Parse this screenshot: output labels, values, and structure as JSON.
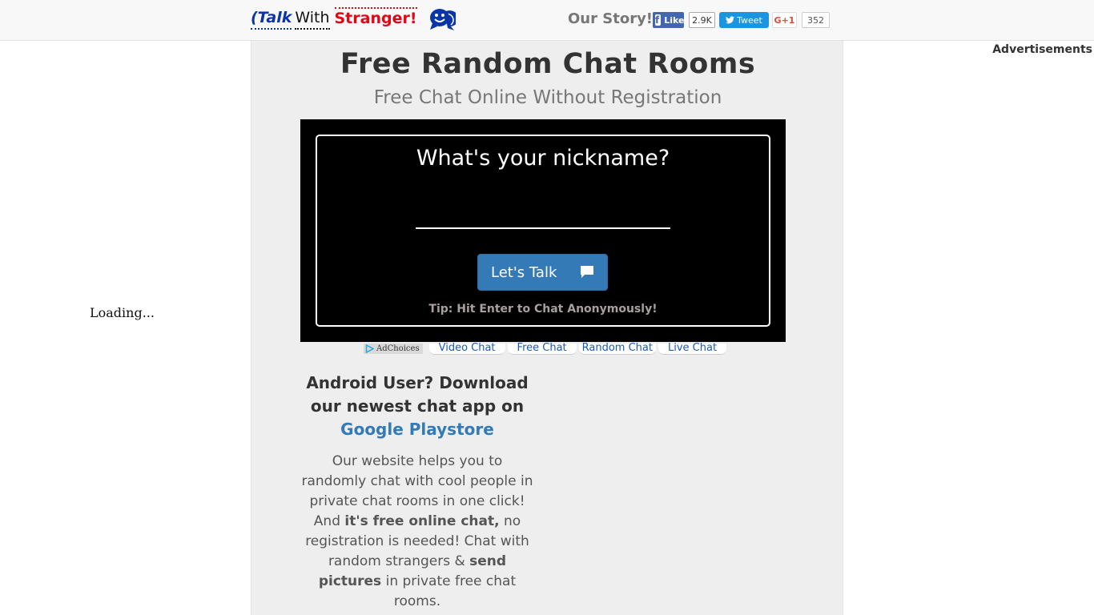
{
  "header": {
    "logo": {
      "part1": "(Talk",
      "part2": "With",
      "part3": "Stranger!",
      "icon": "smiley-chat-bubble-icon"
    },
    "our_story": "Our Story!",
    "facebook": {
      "label": "Like",
      "count": "2.9K",
      "icon": "facebook-icon"
    },
    "twitter": {
      "label": "Tweet",
      "icon": "twitter-bird-icon"
    },
    "gplus": {
      "label": "G+1",
      "count": "352"
    }
  },
  "left_ad": {
    "loading_text": "Loading..."
  },
  "right_ad": {
    "label": "Advertisements"
  },
  "main": {
    "title": "Free Random Chat Rooms",
    "subtitle": "Free Chat Online Without Registration",
    "form": {
      "question": "What's your nickname?",
      "nickname_value": "",
      "button_label": "Let's Talk",
      "button_icon": "speech-bubble-icon",
      "tip": "Tip: Hit Enter to Chat Anonymously!"
    },
    "ad_links": {
      "adchoices": "AdChoices",
      "items": [
        "Video Chat",
        "Free Chat",
        "Random Chat",
        "Live Chat"
      ]
    },
    "android": {
      "line1": "Android User? Download our newest chat app on",
      "link": "Google Playstore"
    },
    "about": {
      "t1": "Our website helps you to randomly chat with cool people in private chat rooms in one click! And ",
      "b1": "it's free online chat,",
      "t2": " no registration is needed! Chat with random strangers & ",
      "b2": "send pictures",
      "t3": " in private free chat rooms."
    }
  },
  "colors": {
    "brand_blue": "#0a35a8",
    "brand_red": "#e30613",
    "button_blue": "#337ab7",
    "facebook": "#4267b2",
    "twitter": "#1b95e0"
  }
}
